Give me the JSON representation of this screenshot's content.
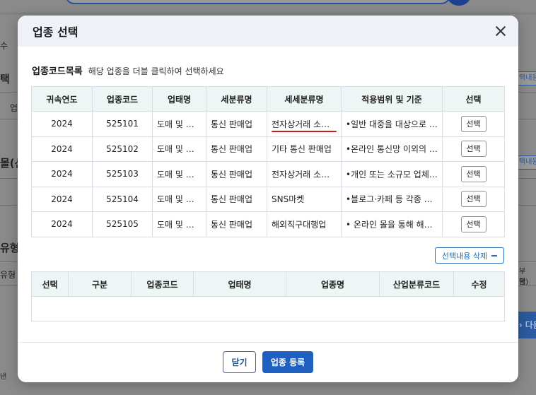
{
  "background": {
    "left_labels": [
      "수",
      "택",
      "업",
      "몰(산",
      "유형",
      "유형",
      "낸"
    ],
    "right_tags": [
      "택내용",
      "택내용"
    ],
    "right_text": [
      "부 함)",
      "택"
    ],
    "next_label": "다음"
  },
  "modal": {
    "title": "업종 선택",
    "section_title": "업종코드목록",
    "section_hint": "해당 업종을 더블 클릭하여 선택하세요",
    "list_headers": [
      "귀속연도",
      "업종코드",
      "업태명",
      "세분류명",
      "세세분류명",
      "적용범위 및 기준",
      "선택"
    ],
    "rows": [
      {
        "year": "2024",
        "code": "525101",
        "biz": "도매 및 소매업",
        "sub": "통신 판매업",
        "subsub": "전자상거래 소매업",
        "scope": "•일반 대중을 대상으로 온라인...",
        "select": "선택"
      },
      {
        "year": "2024",
        "code": "525102",
        "biz": "도매 및 소매업",
        "sub": "통신 판매업",
        "subsub": "기타 통신 판매업",
        "scope": "•온라인 통신망 이외의 통신...",
        "select": "선택"
      },
      {
        "year": "2024",
        "code": "525103",
        "biz": "도매 및 소매업",
        "sub": "통신 판매업",
        "subsub": "전자상거래 소매 중개업",
        "scope": "•개인 또는 소규모 업체가...",
        "select": "선택"
      },
      {
        "year": "2024",
        "code": "525104",
        "biz": "도매 및 소매업",
        "sub": "통신 판매업",
        "subsub": "SNS마켓",
        "scope": "•블로그·카페 등 각종 사회...",
        "select": "선택"
      },
      {
        "year": "2024",
        "code": "525105",
        "biz": "도매 및 소매업",
        "sub": "통신 판매업",
        "subsub": "해외직구대행업",
        "scope": "• 온라인 몰을 통해 해외에서...",
        "select": "선택"
      }
    ],
    "delete_label": "선택내용 삭제",
    "selected_headers": [
      "선택",
      "구분",
      "업종코드",
      "업태명",
      "업종명",
      "산업분류코드",
      "수정"
    ],
    "close_label": "닫기",
    "register_label": "업종 등록"
  }
}
